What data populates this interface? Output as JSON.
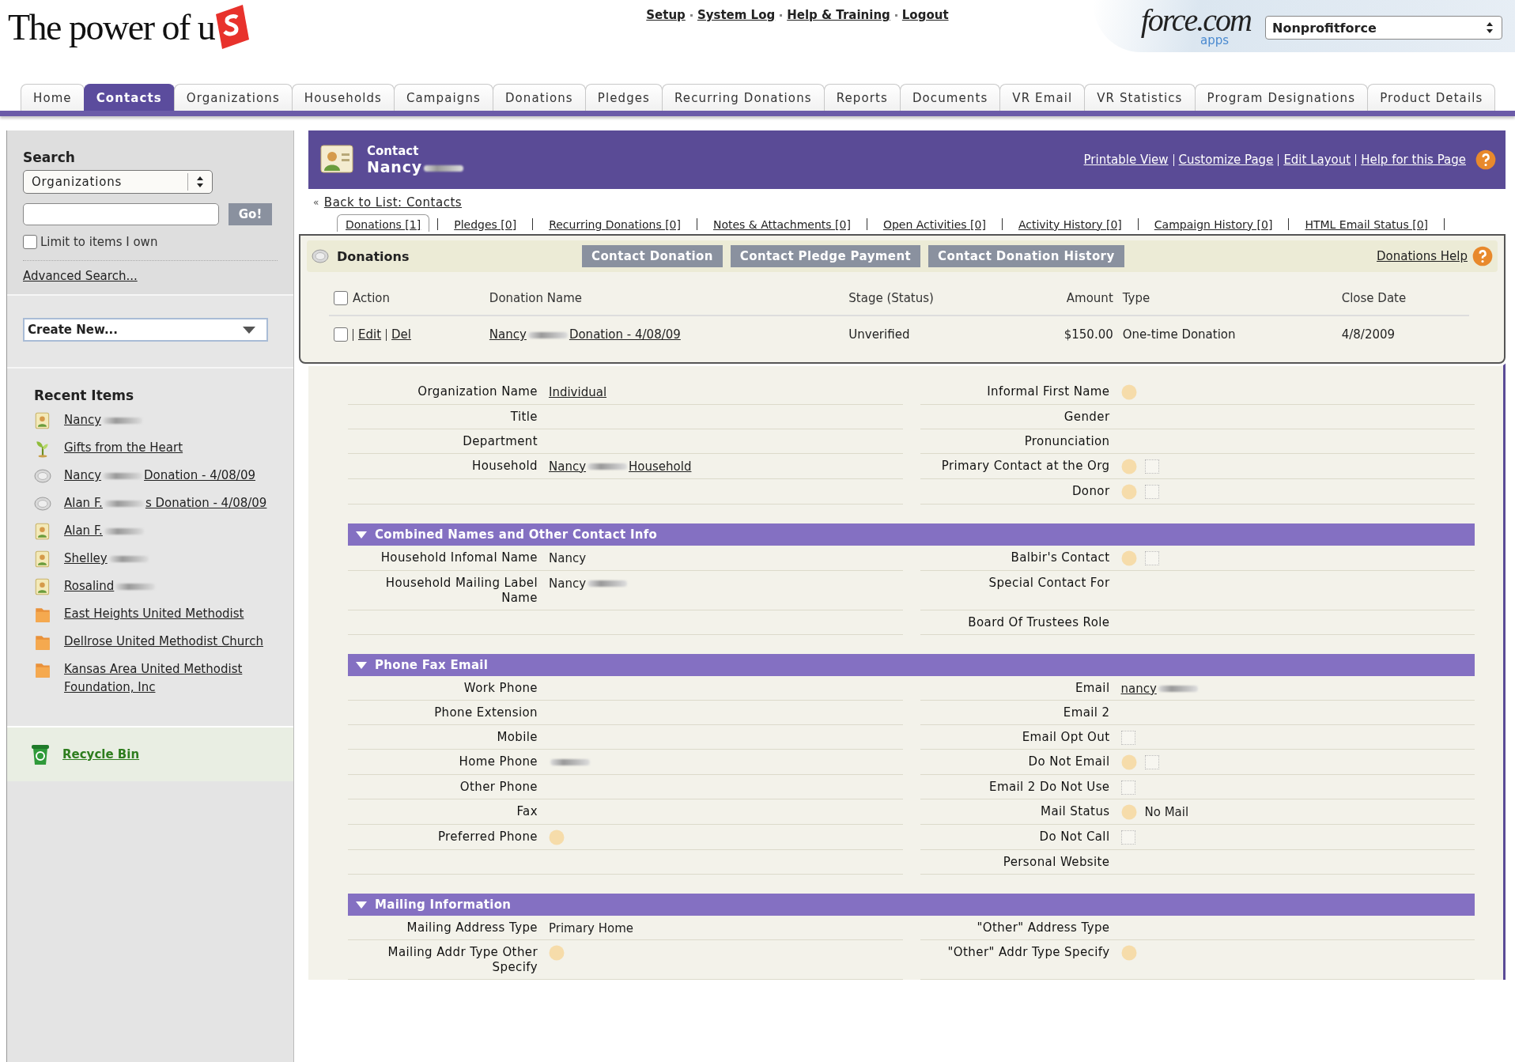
{
  "header": {
    "logo_text": "The power of u",
    "links": [
      "Setup",
      "System Log",
      "Help & Training",
      "Logout"
    ],
    "platform_logo": "force.com",
    "platform_sub": "apps",
    "app_select": "Nonprofitforce"
  },
  "tabs": [
    {
      "label": "Home",
      "selected": false
    },
    {
      "label": "Contacts",
      "selected": true
    },
    {
      "label": "Organizations",
      "selected": false
    },
    {
      "label": "Households",
      "selected": false
    },
    {
      "label": "Campaigns",
      "selected": false
    },
    {
      "label": "Donations",
      "selected": false
    },
    {
      "label": "Pledges",
      "selected": false
    },
    {
      "label": "Recurring Donations",
      "selected": false
    },
    {
      "label": "Reports",
      "selected": false
    },
    {
      "label": "Documents",
      "selected": false
    },
    {
      "label": "VR Email",
      "selected": false
    },
    {
      "label": "VR Statistics",
      "selected": false
    },
    {
      "label": "Program Designations",
      "selected": false
    },
    {
      "label": "Product Details",
      "selected": false
    }
  ],
  "sidebar": {
    "search_title": "Search",
    "search_scope": "Organizations",
    "go_button": "Go!",
    "limit_checkbox": {
      "label": "Limit to items I own",
      "checked": false
    },
    "advanced_search": "Advanced Search...",
    "create_new": "Create New...",
    "recent_title": "Recent Items",
    "recent_items": [
      {
        "kind": "contact",
        "label": [
          "Nancy",
          {
            "kind": "blur"
          }
        ]
      },
      {
        "kind": "campaign",
        "label": "Gifts from the Heart"
      },
      {
        "kind": "donation",
        "label": [
          "Nancy",
          {
            "kind": "blur"
          },
          "Donation - 4/08/09"
        ]
      },
      {
        "kind": "donation",
        "label": [
          "Alan F.",
          {
            "kind": "blur"
          },
          "s Donation - 4/08/09"
        ]
      },
      {
        "kind": "contact",
        "label": [
          "Alan F.",
          {
            "kind": "blur"
          }
        ]
      },
      {
        "kind": "contact",
        "label": [
          "Shelley",
          {
            "kind": "blur"
          }
        ]
      },
      {
        "kind": "contact",
        "label": [
          "Rosalind",
          {
            "kind": "blur"
          }
        ]
      },
      {
        "kind": "organization",
        "label": "East Heights United Methodist"
      },
      {
        "kind": "organization",
        "label": "Dellrose United Methodist Church"
      },
      {
        "kind": "organization",
        "label": "Kansas Area United Methodist Foundation, Inc"
      }
    ],
    "recycle_bin": "Recycle Bin"
  },
  "record": {
    "type": "Contact",
    "name": [
      "Nancy",
      {
        "kind": "blur"
      }
    ],
    "links": [
      "Printable View",
      "Customize Page",
      "Edit Layout",
      "Help for this Page"
    ],
    "back_arrow": "«",
    "back_link": "Back to List: Contacts",
    "related_tabs": [
      {
        "label": "Donations [1]",
        "selected": true
      },
      {
        "label": "Pledges [0]",
        "selected": false
      },
      {
        "label": "Recurring Donations [0]",
        "selected": false
      },
      {
        "label": "Notes & Attachments [0]",
        "selected": false
      },
      {
        "label": "Open Activities [0]",
        "selected": false
      },
      {
        "label": "Activity History [0]",
        "selected": false
      },
      {
        "label": "Campaign History [0]",
        "selected": false
      },
      {
        "label": "HTML Email Status [0]",
        "selected": false
      }
    ]
  },
  "donations": {
    "title": "Donations",
    "buttons": [
      "Contact Donation",
      "Contact Pledge Payment",
      "Contact Donation History"
    ],
    "help_link": "Donations Help",
    "select_all_checked": false,
    "columns": [
      "Action",
      "Donation Name",
      "Stage (Status)",
      "Amount",
      "Type",
      "Close Date"
    ],
    "rows": [
      {
        "checked": false,
        "actions": [
          "Edit",
          "Del"
        ],
        "name": [
          "Nancy",
          {
            "kind": "blur"
          },
          "Donation - 4/08/09"
        ],
        "stage": "Unverified",
        "amount": "$150.00",
        "type": "One-time Donation",
        "close_date": "4/8/2009"
      }
    ]
  },
  "sections": [
    {
      "rows": [
        {
          "left": {
            "label": "Organization Name",
            "kind": "link",
            "value": "Individual"
          },
          "right": {
            "label": "Informal First Name",
            "kind": "text",
            "help": true
          }
        },
        {
          "left": {
            "label": "Title",
            "kind": "text"
          },
          "right": {
            "label": "Gender",
            "kind": "text"
          }
        },
        {
          "left": {
            "label": "Department",
            "kind": "text"
          },
          "right": {
            "label": "Pronunciation",
            "kind": "text"
          }
        },
        {
          "left": {
            "label": "Household",
            "kind": "link",
            "value": [
              "Nancy",
              {
                "kind": "blur"
              },
              "Household"
            ]
          },
          "right": {
            "label": "Primary Contact at the Org",
            "kind": "checkbox",
            "help": true,
            "checked": false
          }
        },
        {
          "right": {
            "label": "Donor",
            "kind": "checkbox",
            "help": true,
            "checked": false
          }
        }
      ]
    },
    {
      "title": "Combined Names and Other Contact Info",
      "expanded": true,
      "rows": [
        {
          "left": {
            "label": "Household Infomal Name",
            "kind": "text",
            "value": "Nancy"
          },
          "right": {
            "label": "Balbir's Contact",
            "kind": "checkbox",
            "help": true,
            "checked": false
          }
        },
        {
          "left": {
            "label": "Household Mailing Label Name",
            "kind": "text",
            "value": [
              "Nancy",
              {
                "kind": "blur"
              }
            ]
          },
          "right": {
            "label": "Special Contact For",
            "kind": "text"
          }
        },
        {
          "right": {
            "label": "Board Of Trustees Role",
            "kind": "text"
          }
        }
      ]
    },
    {
      "title": "Phone Fax Email",
      "expanded": true,
      "rows": [
        {
          "left": {
            "label": "Work Phone",
            "kind": "text"
          },
          "right": {
            "label": "Email",
            "kind": "link",
            "value": [
              "nancy",
              {
                "kind": "blur"
              }
            ]
          }
        },
        {
          "left": {
            "label": "Phone Extension",
            "kind": "text"
          },
          "right": {
            "label": "Email 2",
            "kind": "text"
          }
        },
        {
          "left": {
            "label": "Mobile",
            "kind": "text"
          },
          "right": {
            "label": "Email Opt Out",
            "kind": "checkbox",
            "checked": false
          }
        },
        {
          "left": {
            "label": "Home Phone",
            "kind": "text",
            "value": [
              {
                "kind": "blur"
              }
            ]
          },
          "right": {
            "label": "Do Not Email",
            "kind": "checkbox",
            "help": true,
            "checked": false
          }
        },
        {
          "left": {
            "label": "Other Phone",
            "kind": "text"
          },
          "right": {
            "label": "Email 2 Do Not Use",
            "kind": "checkbox",
            "checked": false
          }
        },
        {
          "left": {
            "label": "Fax",
            "kind": "text"
          },
          "right": {
            "label": "Mail Status",
            "kind": "text",
            "help": true,
            "value": "No Mail"
          }
        },
        {
          "left": {
            "label": "Preferred Phone",
            "kind": "text",
            "help": true
          },
          "right": {
            "label": "Do Not Call",
            "kind": "checkbox",
            "checked": false
          }
        },
        {
          "right": {
            "label": "Personal Website",
            "kind": "text"
          }
        }
      ]
    },
    {
      "title": "Mailing Information",
      "expanded": true,
      "rows": [
        {
          "left": {
            "label": "Mailing Address Type",
            "kind": "text",
            "value": "Primary Home"
          },
          "right": {
            "label": "\"Other\" Address Type",
            "kind": "text"
          }
        },
        {
          "left": {
            "label": "Mailing Addr Type Other Specify",
            "kind": "text",
            "help": true
          },
          "right": {
            "label": "\"Other\" Addr Type Specify",
            "kind": "text",
            "help": true
          }
        }
      ]
    }
  ]
}
